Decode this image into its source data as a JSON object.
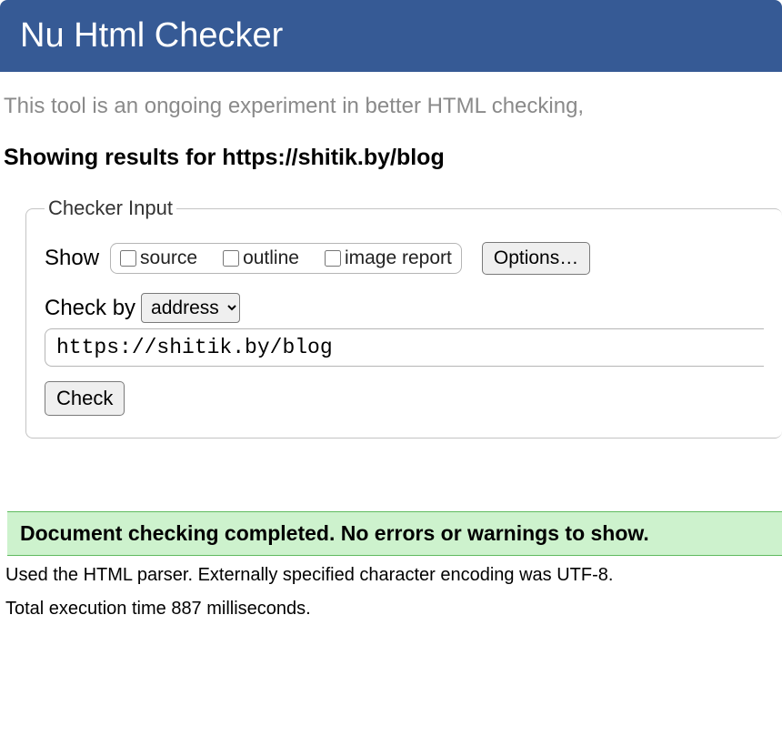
{
  "header": {
    "title": "Nu Html Checker"
  },
  "subtitle": "This tool is an ongoing experiment in better HTML checking,",
  "results_heading": "Showing results for https://shitik.by/blog",
  "checker_input": {
    "legend": "Checker Input",
    "show_label": "Show",
    "checkboxes": {
      "source": "source",
      "outline": "outline",
      "image_report": "image report"
    },
    "options_button": "Options…",
    "check_by_label": "Check by",
    "check_by_selected": "address",
    "url_value": "https://shitik.by/blog",
    "check_button": "Check"
  },
  "results": {
    "success_message": "Document checking completed. No errors or warnings to show.",
    "parser_info": "Used the HTML parser. Externally specified character encoding was UTF-8.",
    "timing_info": "Total execution time 887 milliseconds."
  }
}
